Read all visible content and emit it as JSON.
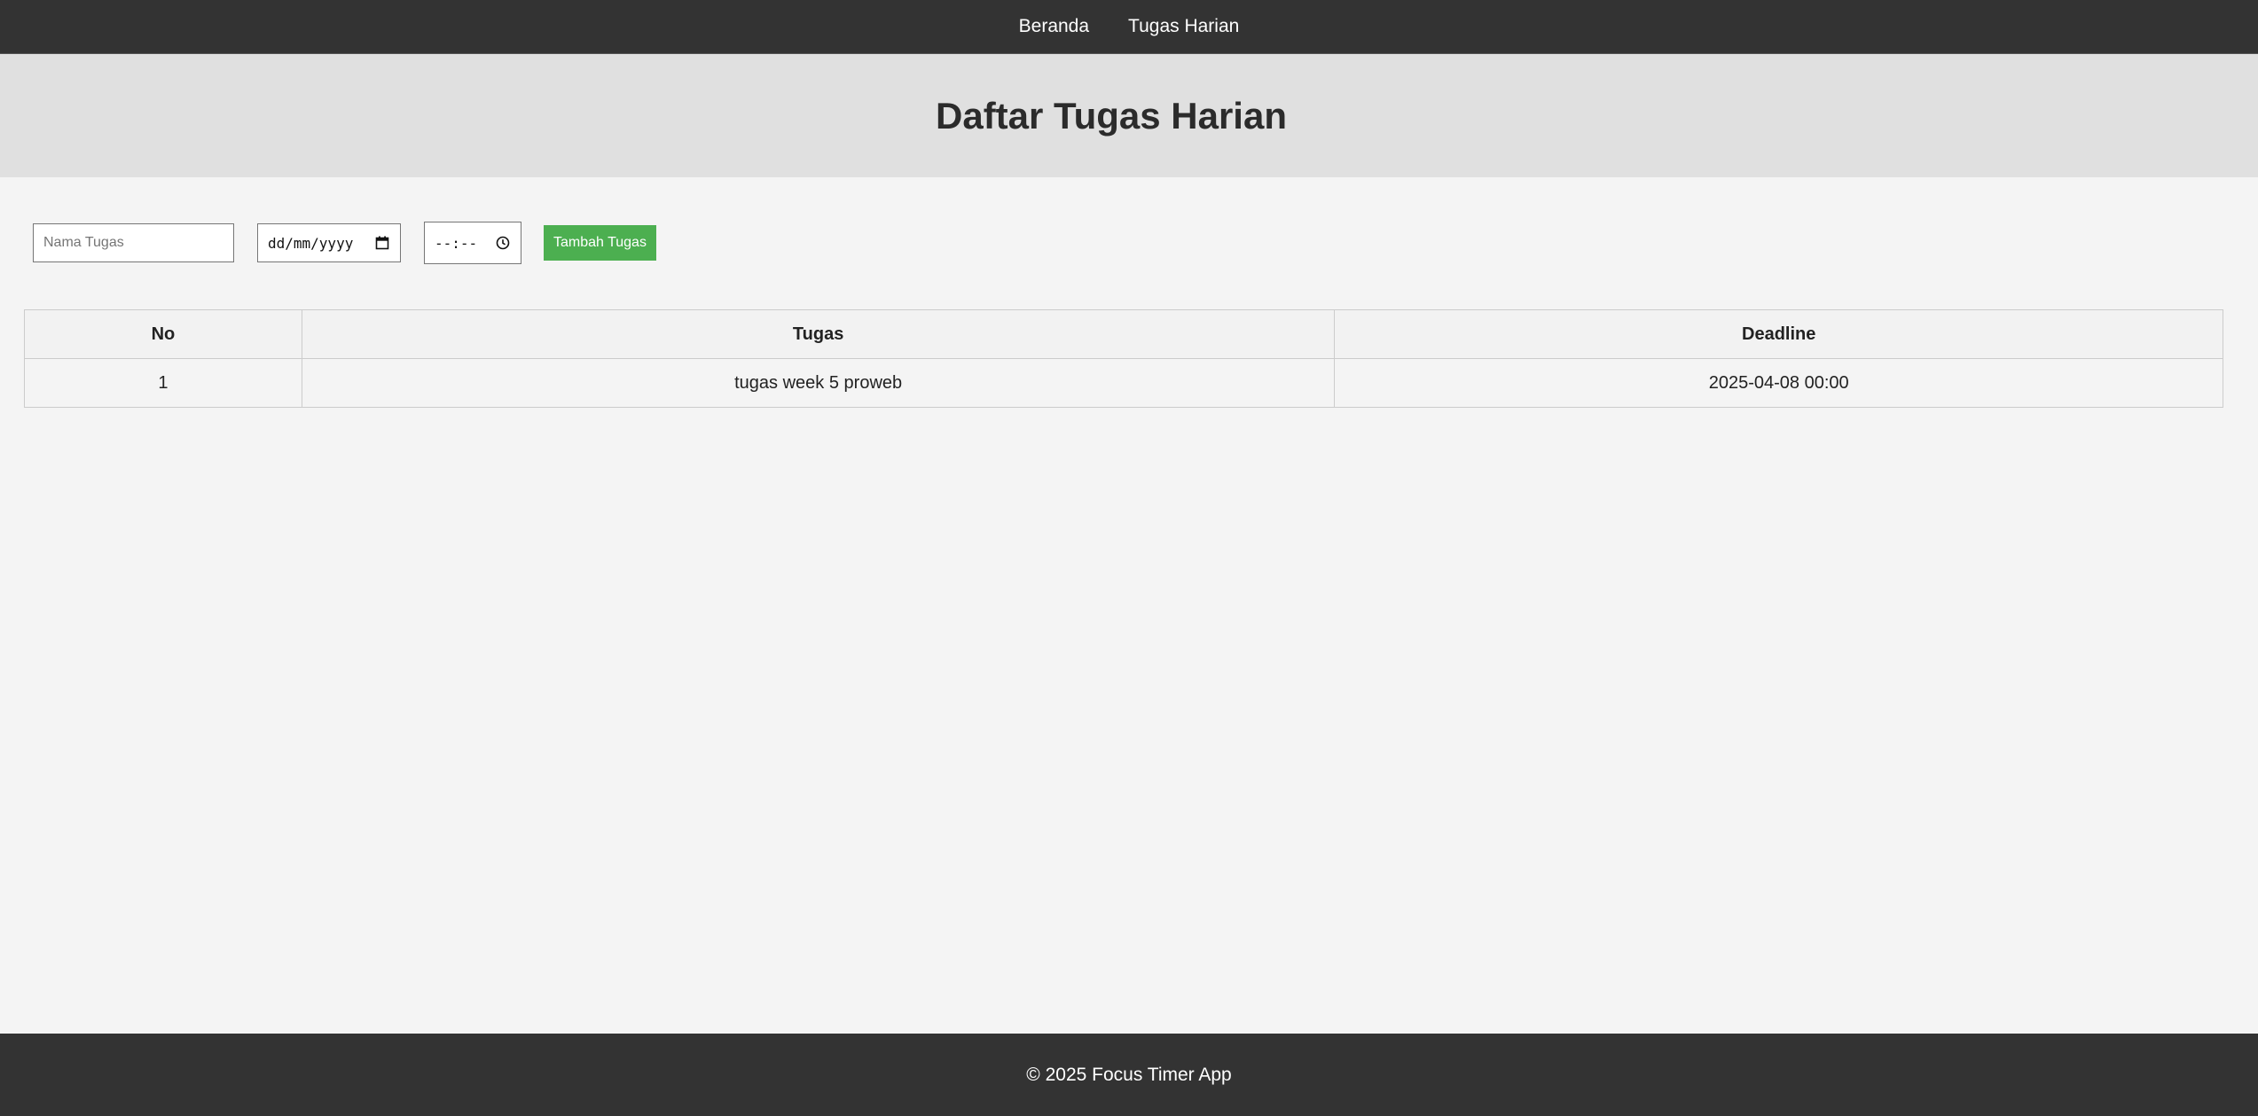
{
  "nav": {
    "items": [
      {
        "label": "Beranda"
      },
      {
        "label": "Tugas Harian"
      }
    ]
  },
  "header": {
    "title": "Daftar Tugas Harian"
  },
  "form": {
    "task_name": {
      "placeholder": "Nama Tugas",
      "value": ""
    },
    "date": {
      "placeholder": "dd/mm/yyyy",
      "value": "",
      "icon": "calendar-icon"
    },
    "time": {
      "placeholder": "--:--",
      "value": "",
      "icon": "clock-icon"
    },
    "submit_label": "Tambah Tugas",
    "submit_color": "#4caf50"
  },
  "table": {
    "headers": [
      "No",
      "Tugas",
      "Deadline"
    ],
    "rows": [
      [
        "1",
        "tugas week 5 proweb",
        "2025-04-08 00:00"
      ]
    ]
  },
  "footer": {
    "text": "© 2025 Focus Timer App"
  },
  "colors": {
    "navbar_bg": "#333333",
    "header_bg": "#e0e0e0",
    "page_bg": "#f4f4f4",
    "accent": "#4caf50"
  }
}
